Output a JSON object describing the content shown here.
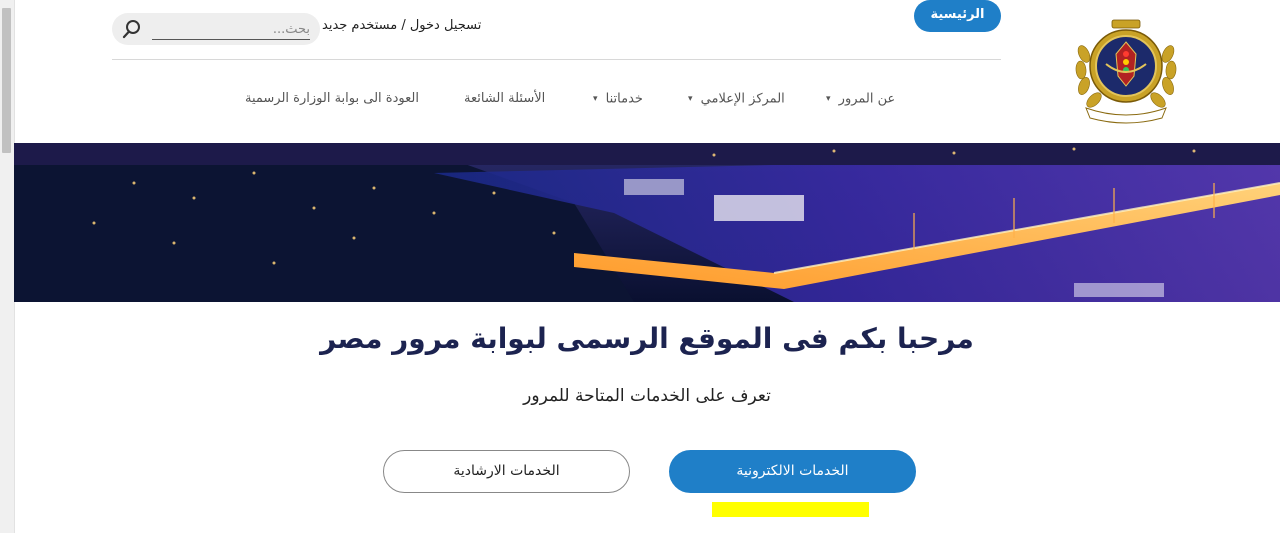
{
  "header": {
    "search": {
      "placeholder": "بحث..."
    },
    "auth": {
      "login_label": "تسجيل دخول",
      "separator": "/",
      "register_label": "مستخدم جديد"
    }
  },
  "nav": {
    "items": [
      {
        "label": "الرئيسية",
        "active": true,
        "dropdown": false
      },
      {
        "label": "عن المرور",
        "active": false,
        "dropdown": true
      },
      {
        "label": "المركز الإعلامي",
        "active": false,
        "dropdown": true
      },
      {
        "label": "خدماتنا",
        "active": false,
        "dropdown": true
      },
      {
        "label": "الأسئلة الشائعة",
        "active": false,
        "dropdown": false
      },
      {
        "label": "العودة الى بوابة الوزارة الرسمية",
        "active": false,
        "dropdown": false
      }
    ],
    "dropdown_glyph": "▾"
  },
  "main": {
    "title": "مرحبا بكم فى الموقع الرسمى لبوابة مرور مصر",
    "subtitle": "تعرف على الخدمات المتاحة للمرور",
    "buttons": {
      "electronic_services": "الخدمات الالكترونية",
      "guidance_services": "الخدمات الارشادية"
    }
  },
  "colors": {
    "primary": "#1f7fc8",
    "title": "#1c2350",
    "highlight": "#ffff00"
  },
  "icons": {
    "search": "search-icon",
    "logo": "traffic-police-emblem"
  }
}
